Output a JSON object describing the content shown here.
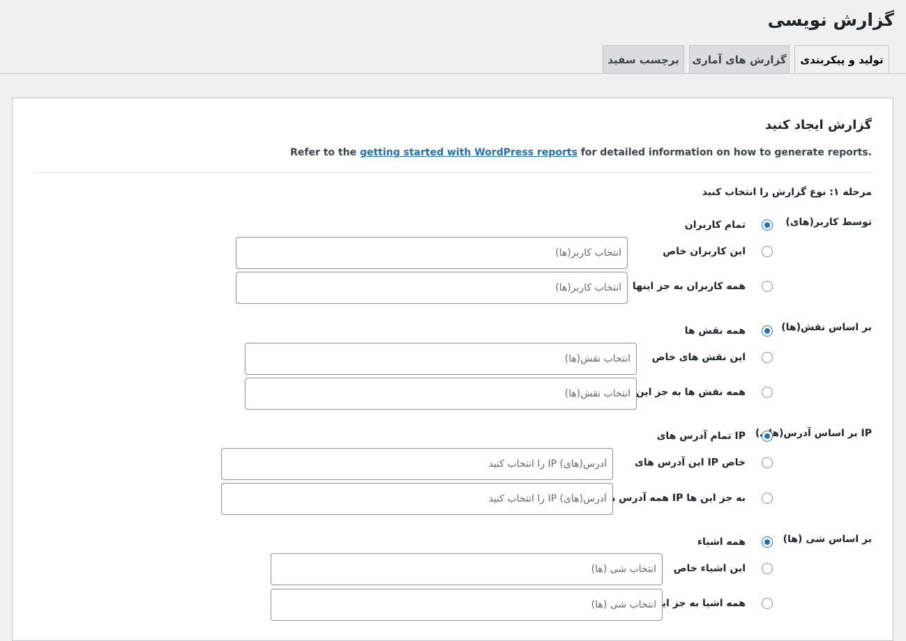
{
  "page": {
    "title": "گزارش نویسی"
  },
  "tabs": [
    {
      "label": "تولید و پیکربندی"
    },
    {
      "label": "گزارش های آماری"
    },
    {
      "label": "برچسب سفید"
    }
  ],
  "panel": {
    "title": "گزارش ایجاد کنید",
    "intro_before": "Refer to the ",
    "intro_link": "getting started with WordPress reports",
    "intro_after": " for detailed information on how to generate reports.",
    "step1": "مرحله ۱: نوع گزارش را انتخاب کنید"
  },
  "groups": [
    {
      "label": "توسط کاربر(های)",
      "options": [
        {
          "label": "تمام کاربران",
          "checked": true
        },
        {
          "label": "این کاربران خاص",
          "placeholder": "انتخاب کاربر(ها)"
        },
        {
          "label": "همه کاربران به جز اینها",
          "placeholder": "انتخاب کاربر(ها)"
        }
      ]
    },
    {
      "label": "بر اساس نقش(ها)",
      "options": [
        {
          "label": "همه نقش ها",
          "checked": true
        },
        {
          "label": "این نقش های خاص",
          "placeholder": "انتخاب نقش(ها)"
        },
        {
          "label": "همه نقش ها به جز این ها",
          "placeholder": "انتخاب نقش(ها)"
        }
      ]
    },
    {
      "label": "بر اساس آدرس(های) IP",
      "options": [
        {
          "label": "تمام آدرس های IP",
          "checked": true
        },
        {
          "label": "این آدرس های IP خاص",
          "placeholder": "آدرس(های) IP را انتخاب کنید"
        },
        {
          "label": "همه آدرس های IP به جز این ها",
          "placeholder": "آدرس(های) IP را انتخاب کنید"
        }
      ]
    },
    {
      "label": "بر اساس شی (ها)",
      "options": [
        {
          "label": "همه اشیاء",
          "checked": true
        },
        {
          "label": "این اشیاء خاص",
          "placeholder": "انتخاب شی (ها)"
        },
        {
          "label": "همه اشیا به جز اینها",
          "placeholder": "انتخاب شی (ها)"
        }
      ]
    }
  ],
  "colors": {
    "accent": "#2271b1",
    "background": "#f0f0f1",
    "panel": "#ffffff"
  }
}
